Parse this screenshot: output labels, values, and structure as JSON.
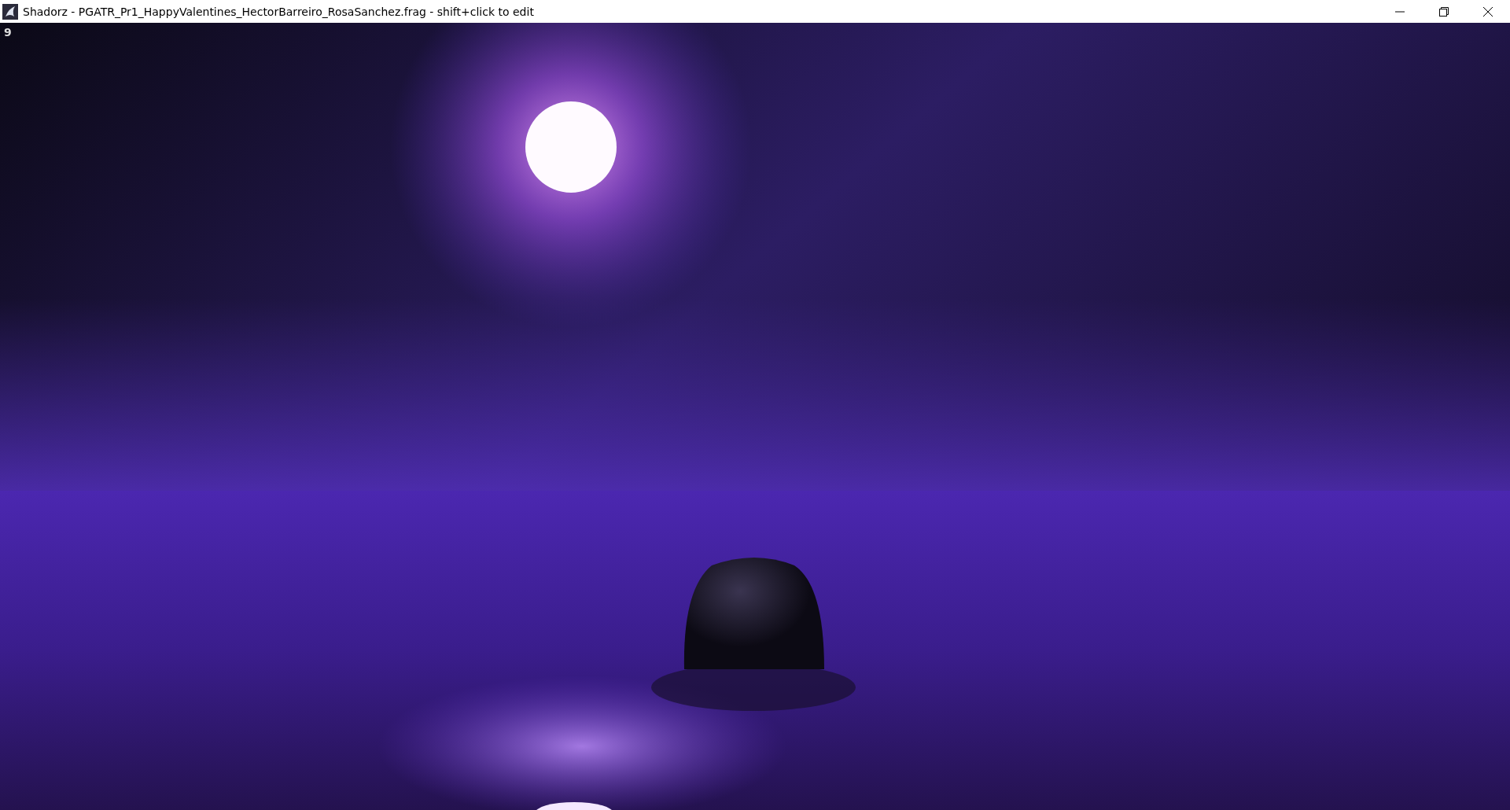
{
  "window": {
    "title": "Shadorz - PGATR_Pr1_HappyValentines_HectorBarreiro_RosaSanchez.frag - shift+click to edit"
  },
  "viewport": {
    "frame_counter": "9"
  }
}
